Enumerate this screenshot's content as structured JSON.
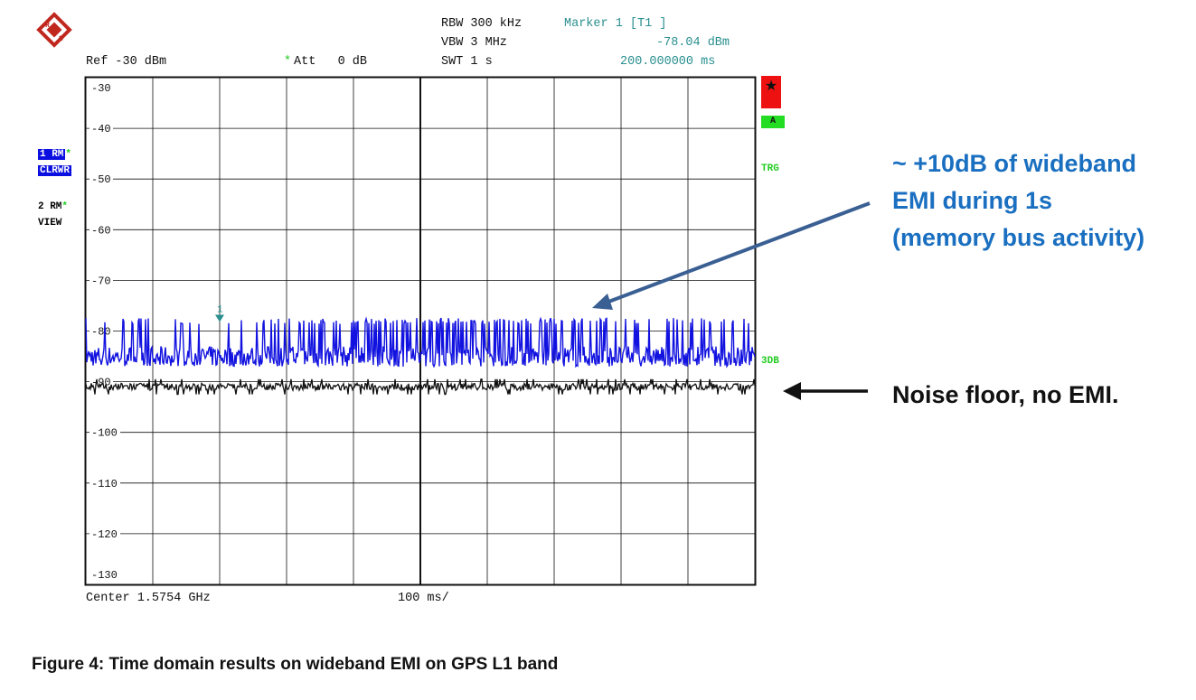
{
  "header": {
    "rbw": "RBW 300 kHz",
    "vbw": "VBW 3 MHz",
    "swt": "SWT 1 s",
    "marker_title": "Marker 1 [T1 ]",
    "marker_level": "-78.04 dBm",
    "marker_time": "200.000000 ms",
    "ref": "Ref -30 dBm",
    "att_star": "*",
    "att": "Att   0 dB"
  },
  "left_panel": {
    "trace1_line1": "1 RM",
    "trace1_line2": "CLRWR",
    "trace1_star": "*",
    "trace2_line1": "2 RM",
    "trace2_line2": "VIEW",
    "trace2_star": "*"
  },
  "right_panel": {
    "star": "★",
    "a_label": "A",
    "trg_label": "TRG",
    "db_label": "3DB"
  },
  "footer": {
    "center": "Center 1.5754 GHz",
    "span": "100 ms/"
  },
  "annotations": {
    "emi_line1": "~ +10dB of wideband",
    "emi_line2": "EMI during 1s",
    "emi_line3": "(memory bus activity)",
    "noise": "Noise floor, no EMI."
  },
  "caption": "Figure 4: Time domain results on wideband EMI on GPS L1 band",
  "colors": {
    "trace_blue": "#1212e0",
    "trace_black": "#111111",
    "marker_teal": "#2a8f8f",
    "annotation_blue": "#1a6fc0",
    "arrow_blue": "#3a5f93",
    "red_box": "#ee1111",
    "green": "#22dd22"
  },
  "chart_data": {
    "type": "line",
    "ylim": [
      -130,
      -30
    ],
    "y_ticks": [
      -30,
      -40,
      -50,
      -60,
      -70,
      -80,
      -90,
      -100,
      -110,
      -120,
      -130
    ],
    "xlim_ms": [
      0,
      1000
    ],
    "x_div_ms": 100,
    "grid": true,
    "marker": {
      "label": "1",
      "x_ms": 200,
      "y": -78.04
    },
    "series": [
      {
        "color": "#1212e0",
        "baseline_dbm": -85,
        "peak_dbm": -78,
        "floor_dbm": -87
      },
      {
        "color": "#111111",
        "baseline_dbm": -91,
        "peak_dbm": -89.5,
        "floor_dbm": -92.5
      }
    ]
  }
}
